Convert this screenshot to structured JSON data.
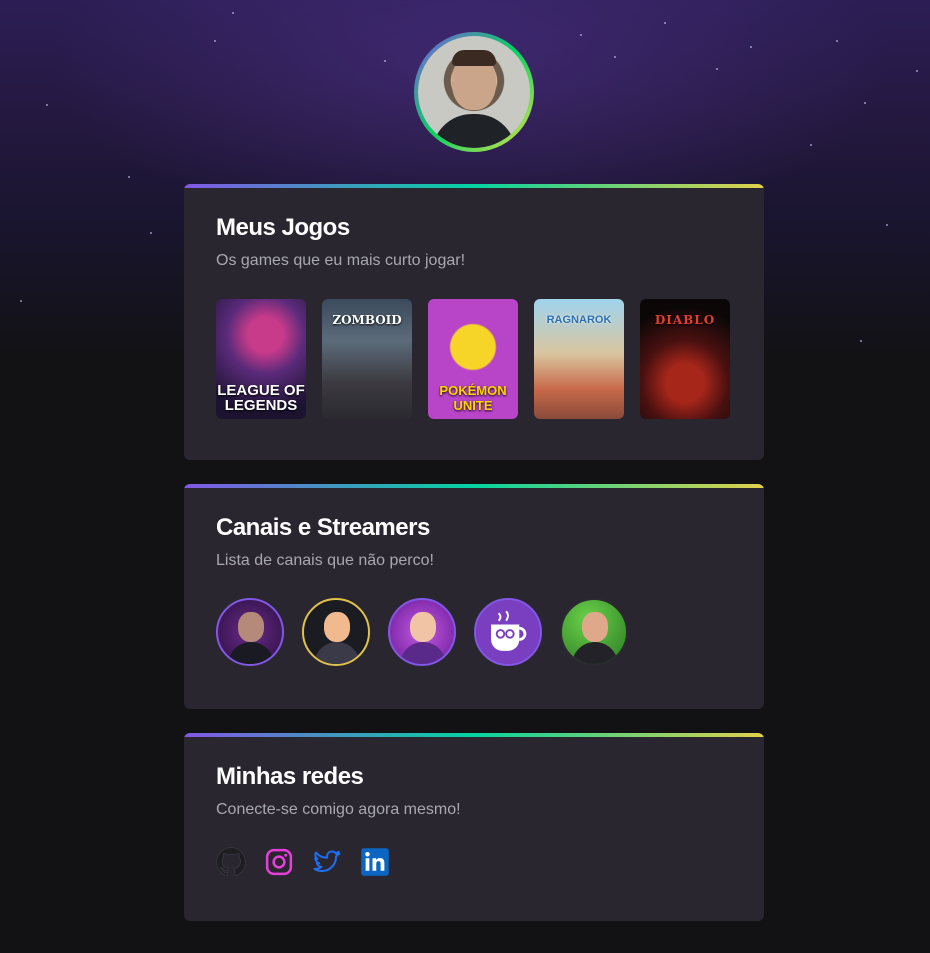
{
  "sections": {
    "games": {
      "title": "Meus Jogos",
      "subtitle": "Os games que eu mais curto jogar!",
      "items": [
        {
          "name": "LEAGUE OF LEGENDS",
          "label": "LEAGUE OF\nLEGENDS"
        },
        {
          "name": "Project Zomboid",
          "label": "ZOMBOID"
        },
        {
          "name": "Pokémon UNITE",
          "label": "POKÉMON\nUNITE"
        },
        {
          "name": "Ragnarok",
          "label": "RAGNAROK"
        },
        {
          "name": "DIABLO",
          "label": "DIABLO"
        }
      ]
    },
    "streamers": {
      "title": "Canais e Streamers",
      "subtitle": "Lista de canais que não perco!"
    },
    "socials": {
      "title": "Minhas redes",
      "subtitle": "Conecte-se comigo agora mesmo!",
      "items": [
        {
          "icon": "github-icon",
          "color": "#8d8d99"
        },
        {
          "icon": "instagram-icon",
          "color": "#e83fdc"
        },
        {
          "icon": "twitter-icon",
          "color": "#1d6ff2"
        },
        {
          "icon": "linkedin-icon",
          "color": "#0a66c2"
        }
      ]
    }
  },
  "colors": {
    "background": "#121214",
    "card": "#29262f",
    "accent_purple": "#8257e5",
    "accent_green": "#04d361",
    "accent_yellow": "#e1e14b"
  }
}
